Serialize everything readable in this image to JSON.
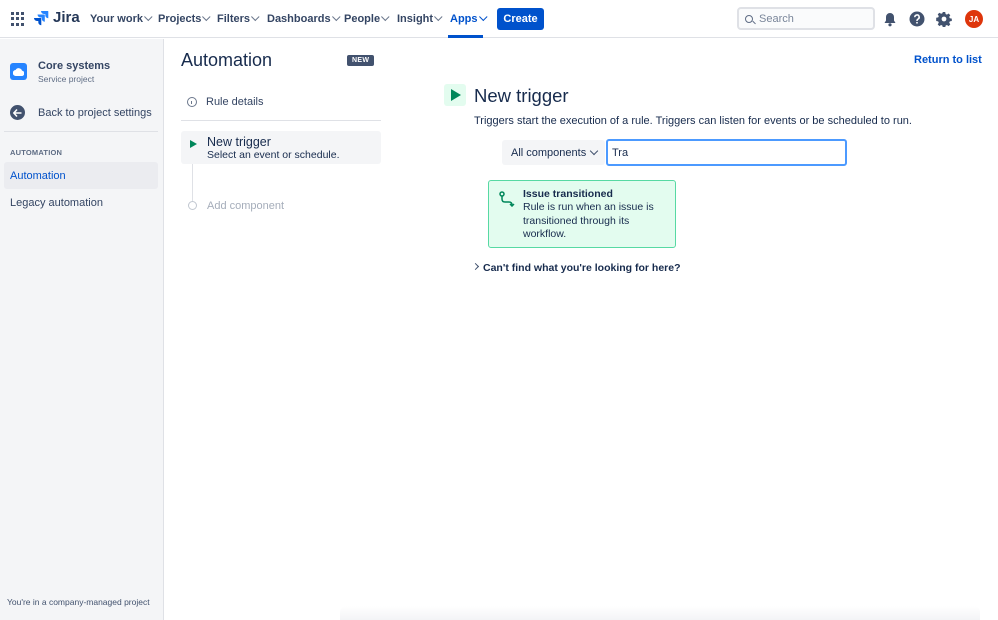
{
  "topnav": {
    "brand": "Jira",
    "items": [
      {
        "label": "Your work"
      },
      {
        "label": "Projects"
      },
      {
        "label": "Filters"
      },
      {
        "label": "Dashboards"
      },
      {
        "label": "People"
      },
      {
        "label": "Insight"
      },
      {
        "label": "Apps",
        "active": true
      }
    ],
    "create_label": "Create",
    "search_placeholder": "Search",
    "avatar_initials": "JA",
    "icons": [
      "app-switcher-icon",
      "bell-icon",
      "help-icon",
      "settings-icon"
    ]
  },
  "sidebar": {
    "project_name": "Core systems",
    "project_type": "Service project",
    "back_label": "Back to project settings",
    "section_label": "AUTOMATION",
    "items": [
      {
        "label": "Automation",
        "selected": true
      },
      {
        "label": "Legacy automation",
        "selected": false
      }
    ],
    "footer": "You're in a company-managed project"
  },
  "rule_panel": {
    "title": "Automation",
    "badge": "NEW",
    "rule_details_label": "Rule details",
    "trigger_title": "New trigger",
    "trigger_subtitle": "Select an event or schedule.",
    "add_component_label": "Add component"
  },
  "main": {
    "return_label": "Return to list",
    "title": "New trigger",
    "description": "Triggers start the execution of a rule. Triggers can listen for events or be scheduled to run.",
    "filter_selected": "All components",
    "filter_input_value": "Tra",
    "result": {
      "title": "Issue transitioned",
      "description": "Rule is run when an issue is transitioned through its workflow."
    },
    "cant_find_label": "Can't find what you're looking for here?"
  },
  "colors": {
    "brand_blue": "#0052cc",
    "trigger_green": "#00875a",
    "result_bg": "#e3fcef",
    "result_border": "#57d9a3",
    "avatar": "#de350b"
  }
}
